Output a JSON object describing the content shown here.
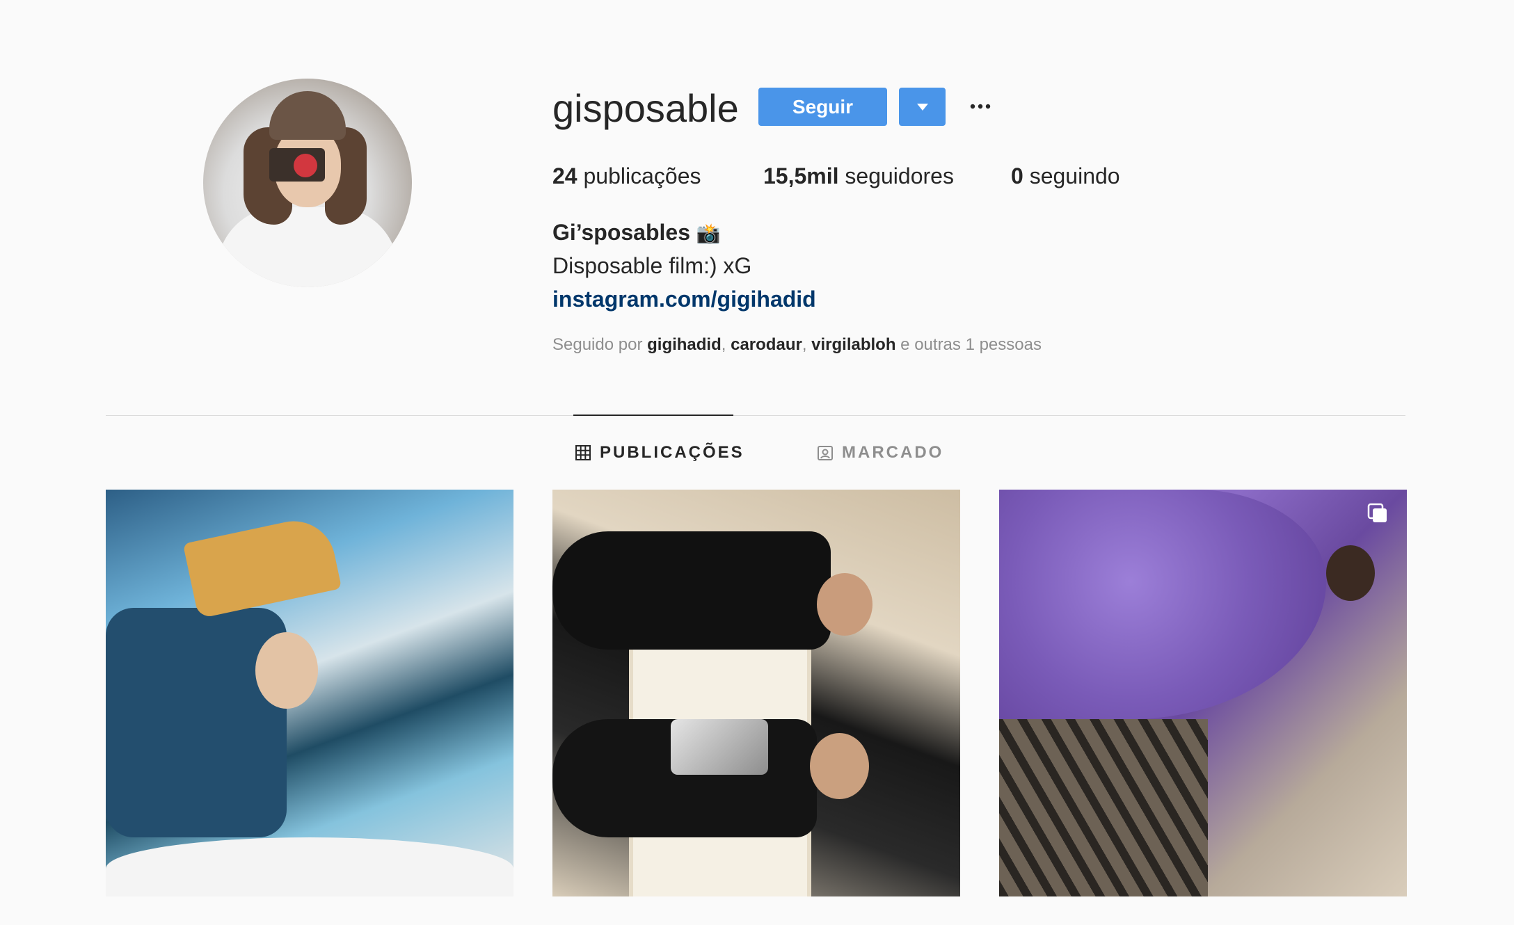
{
  "profile": {
    "username": "gisposable",
    "follow_label": "Seguir",
    "stats": {
      "posts_count": "24",
      "posts_label": " publicações",
      "followers_count": "15,5mil",
      "followers_label": " seguidores",
      "following_count": "0",
      "following_label": " seguindo"
    },
    "bio": {
      "name": "Gi’sposables",
      "emoji": "📸",
      "line": "Disposable film:) xG",
      "link": "instagram.com/gigihadid"
    },
    "followed_by": {
      "prefix": "Seguido por ",
      "accounts": [
        "gigihadid",
        "carodaur",
        "virgilabloh"
      ],
      "separator": ", ",
      "suffix": " e outras 1 pessoas"
    }
  },
  "tabs": [
    {
      "label": "PUBLICAÇÕES",
      "icon": "grid-icon",
      "active": true
    },
    {
      "label": "MARCADO",
      "icon": "tagged-person-icon",
      "active": false
    }
  ],
  "posts": [
    {
      "kind": "photo"
    },
    {
      "kind": "photo"
    },
    {
      "kind": "carousel",
      "icon": "multiple-photos-icon"
    }
  ],
  "colors": {
    "follow_button": "#4a95e9",
    "link": "#00376b",
    "muted_text": "#8e8e8e",
    "background": "#fafafa"
  }
}
